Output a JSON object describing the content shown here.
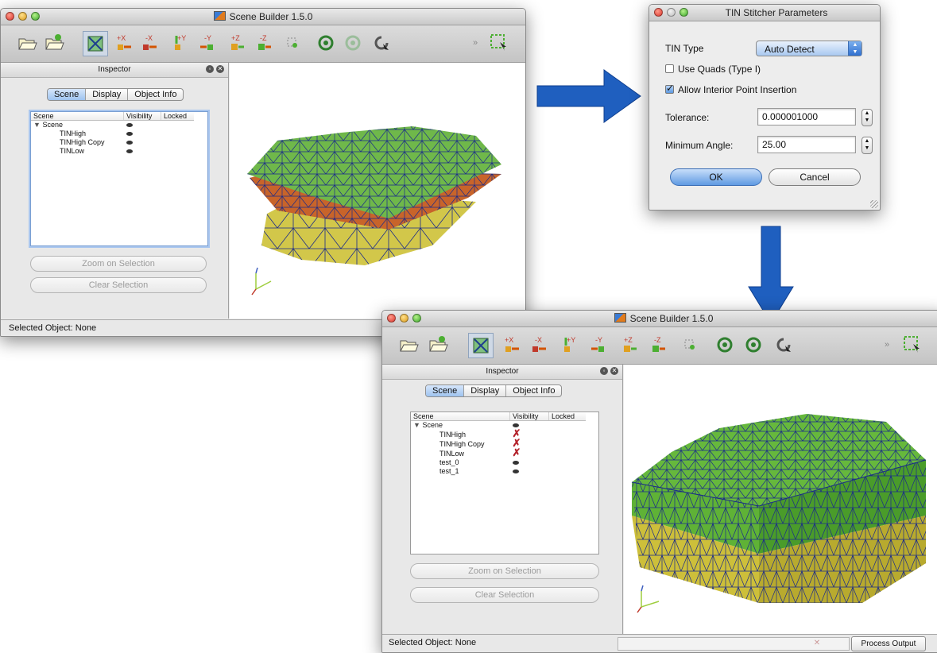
{
  "window1": {
    "title": "Scene Builder 1.5.0",
    "inspector_title": "Inspector",
    "tabs": [
      {
        "label": "Scene",
        "active": true
      },
      {
        "label": "Display",
        "active": false
      },
      {
        "label": "Object Info",
        "active": false
      }
    ],
    "tree_headers": {
      "scene": "Scene",
      "visibility": "Visibility",
      "locked": "Locked"
    },
    "tree_root": "Scene",
    "tree_items": [
      {
        "name": "TINHigh",
        "visible": true
      },
      {
        "name": "TINHigh Copy",
        "visible": true
      },
      {
        "name": "TINLow",
        "visible": true
      }
    ],
    "zoom_button": "Zoom on Selection",
    "clear_button": "Clear Selection",
    "status": "Selected Object: None",
    "toolbar_icons": [
      "open-icon",
      "new-icon",
      "fit-view-icon",
      "view-plus-x-icon",
      "view-minus-x-icon",
      "view-plus-y-icon",
      "view-minus-y-icon",
      "view-plus-z-icon",
      "view-minus-z-icon",
      "oblique-icon",
      "rotate-icon",
      "rotate-disabled-icon",
      "reset-icon",
      "overflow-icon",
      "select-icon"
    ],
    "toolbar_labels": {
      "px": "+X",
      "mx": "-X",
      "py": "+Y",
      "my": "-Y",
      "pz": "+Z",
      "mz": "-Z"
    }
  },
  "dialog": {
    "title": "TIN Stitcher Parameters",
    "tin_type_label": "TIN Type",
    "tin_type_value": "Auto Detect",
    "use_quads_label": "Use Quads (Type I)",
    "use_quads_checked": false,
    "allow_interior_label": "Allow Interior Point Insertion",
    "allow_interior_checked": true,
    "tolerance_label": "Tolerance:",
    "tolerance_value": "0.000001000",
    "min_angle_label": "Minimum Angle:",
    "min_angle_value": "25.00",
    "ok_label": "OK",
    "cancel_label": "Cancel"
  },
  "window2": {
    "title": "Scene Builder 1.5.0",
    "inspector_title": "Inspector",
    "tabs": [
      {
        "label": "Scene",
        "active": true
      },
      {
        "label": "Display",
        "active": false
      },
      {
        "label": "Object Info",
        "active": false
      }
    ],
    "tree_headers": {
      "scene": "Scene",
      "visibility": "Visibility",
      "locked": "Locked"
    },
    "tree_root": "Scene",
    "tree_items": [
      {
        "name": "TINHigh",
        "visible": false
      },
      {
        "name": "TINHigh Copy",
        "visible": false
      },
      {
        "name": "TINLow",
        "visible": false
      },
      {
        "name": "test_0",
        "visible": true
      },
      {
        "name": "test_1",
        "visible": true
      }
    ],
    "zoom_button": "Zoom on Selection",
    "clear_button": "Clear Selection",
    "status": "Selected Object: None",
    "process_output": "Process Output",
    "toolbar_labels": {
      "px": "+X",
      "mx": "-X",
      "py": "+Y",
      "my": "-Y",
      "pz": "+Z",
      "mz": "-Z"
    }
  },
  "colors": {
    "arrow": "#1f5fbf",
    "mesh_green": "#5fb236",
    "mesh_orange": "#c86a2a",
    "mesh_yellow": "#c9c23a",
    "mesh_line": "#1a2a8a"
  }
}
